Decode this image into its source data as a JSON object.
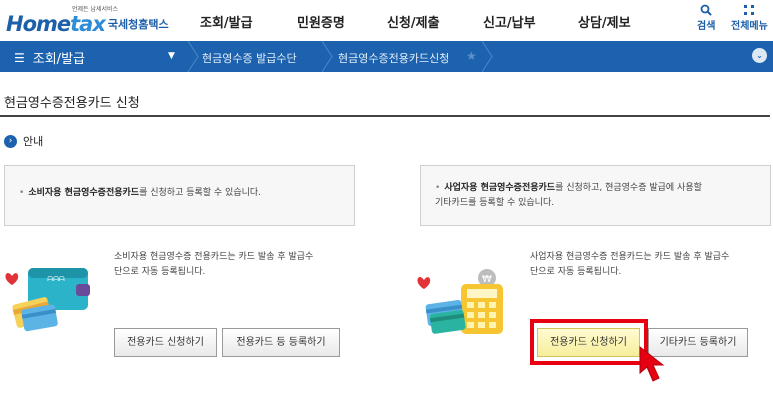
{
  "header": {
    "slogan": "언제든 납세서비스",
    "logo_home": "Home",
    "logo_tax": "tax",
    "logo_kr": "국세청홈택스",
    "gnb": [
      "조회/발급",
      "민원증명",
      "신청/제출",
      "신고/납부",
      "상담/제보"
    ],
    "search_label": "검색",
    "allmenu_label": "전체메뉴"
  },
  "navbar": {
    "menu_label": "조회/발급",
    "crumb1": "현금영수증 발급수단",
    "crumb2": "현금영수증전용카드신청"
  },
  "page": {
    "title": "현금영수증전용카드 신청",
    "info_label": "안내"
  },
  "left": {
    "notice_bold": "소비자용 현금영수증전용카드",
    "notice_rest": "를 신청하고 등록할 수 있습니다.",
    "desc_line1": "소비자용 현금영수증 전용카드는 카드 발송 후 발급수",
    "desc_line2": "단으로 자동 등록됩니다.",
    "btn_apply": "전용카드 신청하기",
    "btn_register": "전용카드 등 등록하기"
  },
  "right": {
    "notice_bold": "사업자용 현금영수증전용카드",
    "notice_rest1": "를 신청하고, 현금영수증 발급에 사용할",
    "notice_rest2": "기타카드를 등록할 수 있습니다.",
    "desc_line1": "사업자용 현금영수증 전용카드는 카드 발송 후 발급수",
    "desc_line2": "단으로 자동 등록됩니다.",
    "btn_apply": "전용카드 신청하기",
    "btn_register": "기타카드 등록하기"
  },
  "colors": {
    "brand_blue": "#1c62ae",
    "highlight_red": "#e60012",
    "button_yellow": "#f6ee9c"
  }
}
